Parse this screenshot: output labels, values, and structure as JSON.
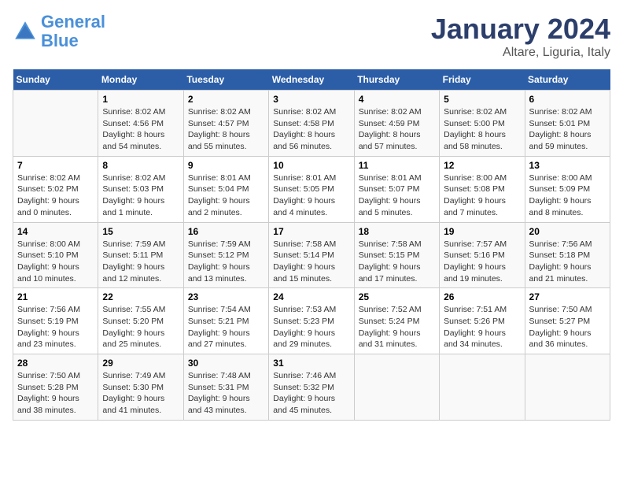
{
  "logo": {
    "line1": "General",
    "line2": "Blue"
  },
  "title": "January 2024",
  "subtitle": "Altare, Liguria, Italy",
  "days_of_week": [
    "Sunday",
    "Monday",
    "Tuesday",
    "Wednesday",
    "Thursday",
    "Friday",
    "Saturday"
  ],
  "weeks": [
    [
      {
        "day": "",
        "info": ""
      },
      {
        "day": "1",
        "info": "Sunrise: 8:02 AM\nSunset: 4:56 PM\nDaylight: 8 hours\nand 54 minutes."
      },
      {
        "day": "2",
        "info": "Sunrise: 8:02 AM\nSunset: 4:57 PM\nDaylight: 8 hours\nand 55 minutes."
      },
      {
        "day": "3",
        "info": "Sunrise: 8:02 AM\nSunset: 4:58 PM\nDaylight: 8 hours\nand 56 minutes."
      },
      {
        "day": "4",
        "info": "Sunrise: 8:02 AM\nSunset: 4:59 PM\nDaylight: 8 hours\nand 57 minutes."
      },
      {
        "day": "5",
        "info": "Sunrise: 8:02 AM\nSunset: 5:00 PM\nDaylight: 8 hours\nand 58 minutes."
      },
      {
        "day": "6",
        "info": "Sunrise: 8:02 AM\nSunset: 5:01 PM\nDaylight: 8 hours\nand 59 minutes."
      }
    ],
    [
      {
        "day": "7",
        "info": "Sunrise: 8:02 AM\nSunset: 5:02 PM\nDaylight: 9 hours\nand 0 minutes."
      },
      {
        "day": "8",
        "info": "Sunrise: 8:02 AM\nSunset: 5:03 PM\nDaylight: 9 hours\nand 1 minute."
      },
      {
        "day": "9",
        "info": "Sunrise: 8:01 AM\nSunset: 5:04 PM\nDaylight: 9 hours\nand 2 minutes."
      },
      {
        "day": "10",
        "info": "Sunrise: 8:01 AM\nSunset: 5:05 PM\nDaylight: 9 hours\nand 4 minutes."
      },
      {
        "day": "11",
        "info": "Sunrise: 8:01 AM\nSunset: 5:07 PM\nDaylight: 9 hours\nand 5 minutes."
      },
      {
        "day": "12",
        "info": "Sunrise: 8:00 AM\nSunset: 5:08 PM\nDaylight: 9 hours\nand 7 minutes."
      },
      {
        "day": "13",
        "info": "Sunrise: 8:00 AM\nSunset: 5:09 PM\nDaylight: 9 hours\nand 8 minutes."
      }
    ],
    [
      {
        "day": "14",
        "info": "Sunrise: 8:00 AM\nSunset: 5:10 PM\nDaylight: 9 hours\nand 10 minutes."
      },
      {
        "day": "15",
        "info": "Sunrise: 7:59 AM\nSunset: 5:11 PM\nDaylight: 9 hours\nand 12 minutes."
      },
      {
        "day": "16",
        "info": "Sunrise: 7:59 AM\nSunset: 5:12 PM\nDaylight: 9 hours\nand 13 minutes."
      },
      {
        "day": "17",
        "info": "Sunrise: 7:58 AM\nSunset: 5:14 PM\nDaylight: 9 hours\nand 15 minutes."
      },
      {
        "day": "18",
        "info": "Sunrise: 7:58 AM\nSunset: 5:15 PM\nDaylight: 9 hours\nand 17 minutes."
      },
      {
        "day": "19",
        "info": "Sunrise: 7:57 AM\nSunset: 5:16 PM\nDaylight: 9 hours\nand 19 minutes."
      },
      {
        "day": "20",
        "info": "Sunrise: 7:56 AM\nSunset: 5:18 PM\nDaylight: 9 hours\nand 21 minutes."
      }
    ],
    [
      {
        "day": "21",
        "info": "Sunrise: 7:56 AM\nSunset: 5:19 PM\nDaylight: 9 hours\nand 23 minutes."
      },
      {
        "day": "22",
        "info": "Sunrise: 7:55 AM\nSunset: 5:20 PM\nDaylight: 9 hours\nand 25 minutes."
      },
      {
        "day": "23",
        "info": "Sunrise: 7:54 AM\nSunset: 5:21 PM\nDaylight: 9 hours\nand 27 minutes."
      },
      {
        "day": "24",
        "info": "Sunrise: 7:53 AM\nSunset: 5:23 PM\nDaylight: 9 hours\nand 29 minutes."
      },
      {
        "day": "25",
        "info": "Sunrise: 7:52 AM\nSunset: 5:24 PM\nDaylight: 9 hours\nand 31 minutes."
      },
      {
        "day": "26",
        "info": "Sunrise: 7:51 AM\nSunset: 5:26 PM\nDaylight: 9 hours\nand 34 minutes."
      },
      {
        "day": "27",
        "info": "Sunrise: 7:50 AM\nSunset: 5:27 PM\nDaylight: 9 hours\nand 36 minutes."
      }
    ],
    [
      {
        "day": "28",
        "info": "Sunrise: 7:50 AM\nSunset: 5:28 PM\nDaylight: 9 hours\nand 38 minutes."
      },
      {
        "day": "29",
        "info": "Sunrise: 7:49 AM\nSunset: 5:30 PM\nDaylight: 9 hours\nand 41 minutes."
      },
      {
        "day": "30",
        "info": "Sunrise: 7:48 AM\nSunset: 5:31 PM\nDaylight: 9 hours\nand 43 minutes."
      },
      {
        "day": "31",
        "info": "Sunrise: 7:46 AM\nSunset: 5:32 PM\nDaylight: 9 hours\nand 45 minutes."
      },
      {
        "day": "",
        "info": ""
      },
      {
        "day": "",
        "info": ""
      },
      {
        "day": "",
        "info": ""
      }
    ]
  ]
}
